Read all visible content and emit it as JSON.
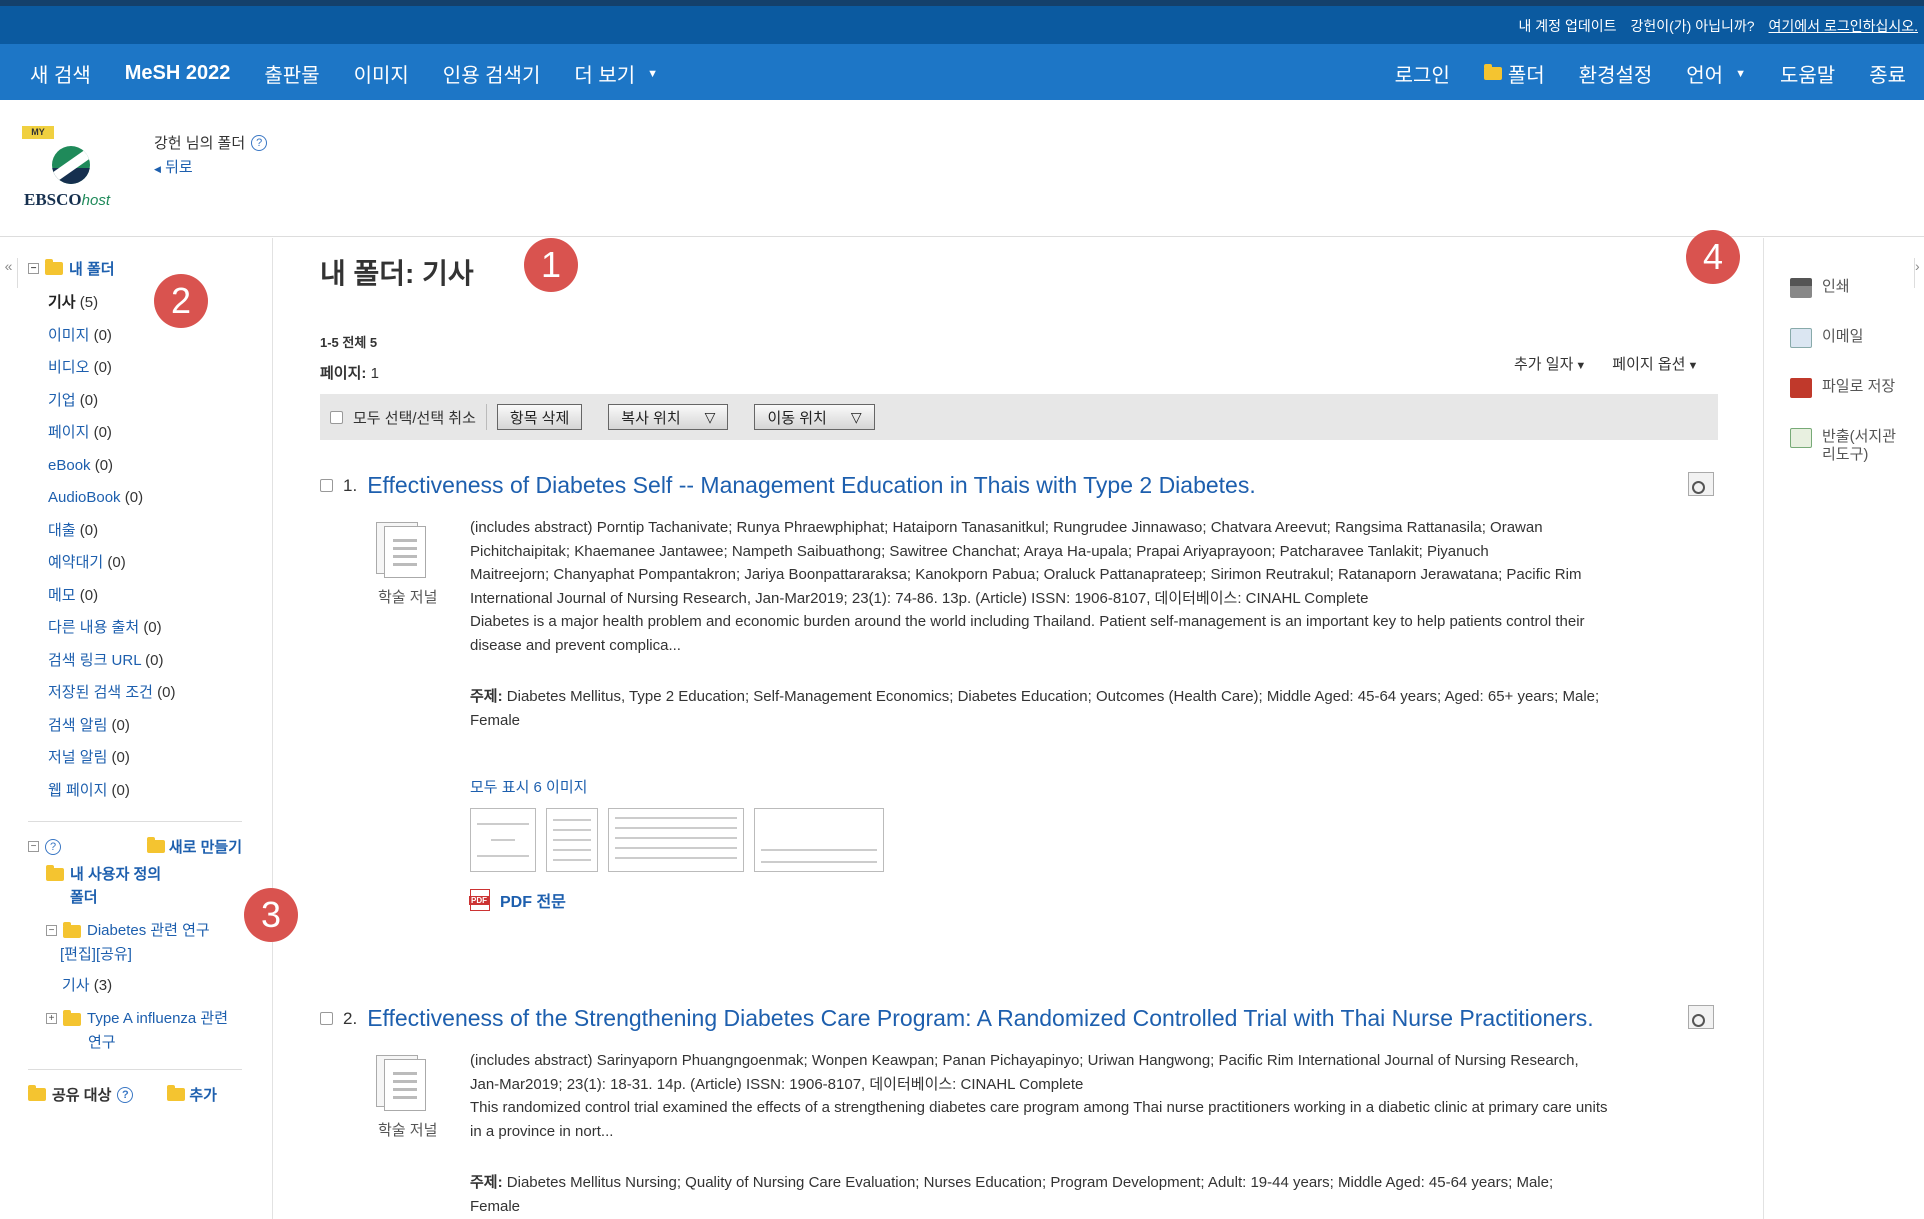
{
  "account_bar": {
    "update": "내 계정 업데이트",
    "not_you": "강헌이(가) 아닙니까?",
    "login_here": "여기에서 로그인하십시오."
  },
  "nav": {
    "left": [
      "새 검색",
      "MeSH 2022",
      "출판물",
      "이미지",
      "인용 검색기",
      "더 보기"
    ],
    "right": [
      "로그인",
      "폴더",
      "환경설정",
      "언어",
      "도움말",
      "종료"
    ]
  },
  "header": {
    "logo_my": "MY",
    "logo_text": "EBSCO",
    "logo_host": "host",
    "folder_owner": "강헌 님의 폴더",
    "back": "뒤로"
  },
  "sidebar": {
    "my_folder": "내 폴더",
    "items": [
      {
        "label": "기사",
        "count": "(5)"
      },
      {
        "label": "이미지",
        "count": "(0)"
      },
      {
        "label": "비디오",
        "count": "(0)"
      },
      {
        "label": "기업",
        "count": "(0)"
      },
      {
        "label": "페이지",
        "count": "(0)"
      },
      {
        "label": "eBook",
        "count": "(0)"
      },
      {
        "label": "AudioBook",
        "count": "(0)"
      },
      {
        "label": "대출",
        "count": "(0)"
      },
      {
        "label": "예약대기",
        "count": "(0)"
      },
      {
        "label": "메모",
        "count": "(0)"
      },
      {
        "label": "다른 내용 출처",
        "count": "(0)"
      },
      {
        "label": "검색 링크 URL",
        "count": "(0)"
      },
      {
        "label": "저장된 검색 조건",
        "count": "(0)"
      },
      {
        "label": "검색 알림",
        "count": "(0)"
      },
      {
        "label": "저널 알림",
        "count": "(0)"
      },
      {
        "label": "웹 페이지",
        "count": "(0)"
      }
    ],
    "new_folder": "새로 만들기",
    "custom_title_1": "내 사용자 정의",
    "custom_title_2": "폴더",
    "sub1_label": "Diabetes 관련 연구",
    "sub1_edit": "[편집]",
    "sub1_share": "[공유]",
    "sub1_article": "기사",
    "sub1_article_count": "(3)",
    "sub2_label_1": "Type A influenza 관련",
    "sub2_label_2": "연구",
    "share_target": "공유 대상",
    "share_add": "추가"
  },
  "main": {
    "title": "내 폴더: 기사",
    "range": "1-5 전체 5",
    "pages_label": "페이지:",
    "pages_value": "1",
    "sort_date": "추가 일자",
    "page_options": "페이지 옵션",
    "select_all": "모두 선택/선택 취소",
    "delete_items": "항목 삭제",
    "copy_to": "복사 위치",
    "move_to": "이동 위치"
  },
  "results": [
    {
      "num": "1.",
      "title": "Effectiveness of Diabetes Self -- Management Education in Thais with Type 2 Diabetes.",
      "doc_type": "학술 저널",
      "lines": [
        "(includes abstract) Porntip Tachanivate; Runya Phraewphiphat; Hataiporn Tanasanitkul; Rungrudee Jinnawaso; Chatvara Areevut; Rangsima Rattanasila; Orawan",
        "Pichitchaipitak; Khaemanee Jantawee; Nampeth Saibuathong; Sawitree Chanchat; Araya Ha-upala; Prapai Ariyaprayoon; Patcharavee Tanlakit; Piyanuch",
        "Maitreejorn; Chanyaphat Pompantakron; Jariya Boonpattararaksa; Kanokporn Pabua; Oraluck Pattanaprateep; Sirimon Reutrakul; Ratanaporn Jerawatana; Pacific Rim",
        "International Journal of Nursing Research, Jan-Mar2019; 23(1): 74-86. 13p. (Article) ISSN: 1906-8107, 데이터베이스: CINAHL Complete",
        "Diabetes is a major health problem and economic burden around the world including Thailand. Patient self-management is an important key to help patients control their",
        "disease and prevent complica..."
      ],
      "subject_label": "주제:",
      "subject_1": "Diabetes Mellitus, Type 2 Education; Self-Management Economics; Diabetes Education; Outcomes (Health Care); Middle Aged: 45-64 years; Aged: 65+ years; Male;",
      "subject_2": "Female",
      "images_link": "모두 표시 6 이미지",
      "pdf": "PDF 전문"
    },
    {
      "num": "2.",
      "title": "Effectiveness of the Strengthening Diabetes Care Program: A Randomized Controlled Trial with Thai Nurse Practitioners.",
      "doc_type": "학술 저널",
      "lines": [
        "(includes abstract) Sarinyaporn Phuangngoenmak; Wonpen Keawpan; Panan Pichayapinyo; Uriwan Hangwong; Pacific Rim International Journal of Nursing Research,",
        "Jan-Mar2019; 23(1): 18-31. 14p. (Article) ISSN: 1906-8107, 데이터베이스: CINAHL Complete",
        "This randomized control trial examined the effects of a strengthening diabetes care program among Thai nurse practitioners working in a diabetic clinic at primary care units",
        "in a province in nort..."
      ],
      "subject_label": "주제:",
      "subject_1": "Diabetes Mellitus Nursing; Quality of Nursing Care Evaluation; Nurses Education; Program Development; Adult: 19-44 years; Middle Aged: 45-64 years; Male;",
      "subject_2": "Female"
    }
  ],
  "tools": [
    "인쇄",
    "이메일",
    "파일로 저장",
    "반출(서지관",
    "리도구)"
  ],
  "markers": [
    "1",
    "2",
    "3",
    "4"
  ],
  "colors": {
    "nav": "#1d76c6",
    "account_bar": "#0b5aa0",
    "link": "#1d5fae",
    "marker": "#d9534f"
  }
}
